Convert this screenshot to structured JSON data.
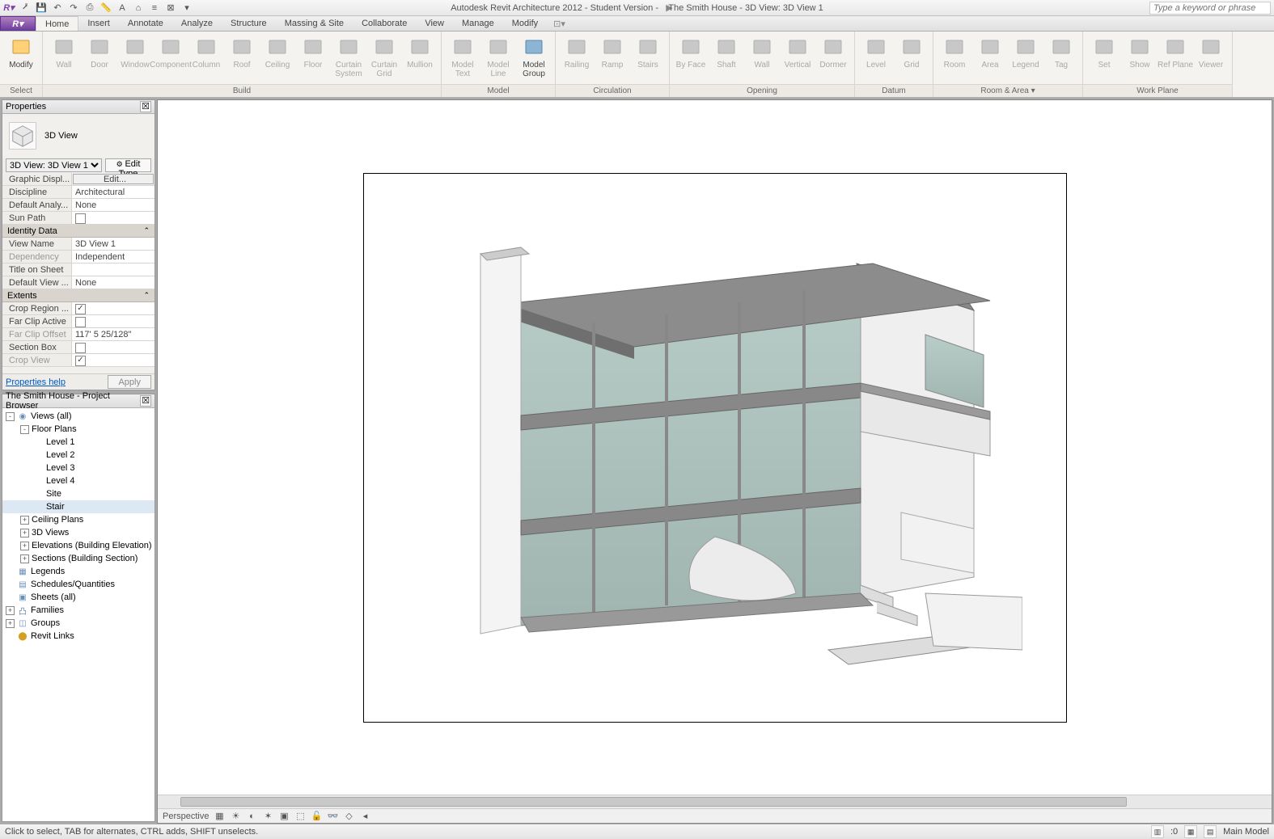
{
  "titlebar": {
    "app": "Autodesk Revit Architecture 2012 - Student Version -",
    "doc": "The Smith House - 3D View: 3D View 1",
    "search_ph": "Type a keyword or phrase"
  },
  "tabs": [
    "Home",
    "Insert",
    "Annotate",
    "Analyze",
    "Structure",
    "Massing & Site",
    "Collaborate",
    "View",
    "Manage",
    "Modify"
  ],
  "active_tab": "Home",
  "ribbon": {
    "select": {
      "title": "Select",
      "items": [
        {
          "id": "modify",
          "label": "Modify",
          "enabled": true,
          "sel": true
        }
      ]
    },
    "build": {
      "title": "Build",
      "items": [
        {
          "id": "wall",
          "label": "Wall"
        },
        {
          "id": "door",
          "label": "Door"
        },
        {
          "id": "window",
          "label": "Window"
        },
        {
          "id": "component",
          "label": "Component"
        },
        {
          "id": "column",
          "label": "Column"
        },
        {
          "id": "roof",
          "label": "Roof"
        },
        {
          "id": "ceiling",
          "label": "Ceiling"
        },
        {
          "id": "floor",
          "label": "Floor"
        },
        {
          "id": "curtain-system",
          "label": "Curtain System"
        },
        {
          "id": "curtain-grid",
          "label": "Curtain Grid"
        },
        {
          "id": "mullion",
          "label": "Mullion"
        }
      ]
    },
    "model": {
      "title": "Model",
      "items": [
        {
          "id": "model-text",
          "label": "Model Text"
        },
        {
          "id": "model-line",
          "label": "Model Line"
        },
        {
          "id": "model-group",
          "label": "Model Group",
          "enabled": true
        }
      ]
    },
    "circulation": {
      "title": "Circulation",
      "items": [
        {
          "id": "railing",
          "label": "Railing"
        },
        {
          "id": "ramp",
          "label": "Ramp"
        },
        {
          "id": "stairs",
          "label": "Stairs"
        }
      ]
    },
    "opening": {
      "title": "Opening",
      "items": [
        {
          "id": "by-face",
          "label": "By Face"
        },
        {
          "id": "shaft",
          "label": "Shaft"
        },
        {
          "id": "wall-open",
          "label": "Wall"
        },
        {
          "id": "vertical",
          "label": "Vertical"
        },
        {
          "id": "dormer",
          "label": "Dormer"
        }
      ]
    },
    "datum": {
      "title": "Datum",
      "items": [
        {
          "id": "level",
          "label": "Level"
        },
        {
          "id": "grid",
          "label": "Grid"
        }
      ]
    },
    "room_area": {
      "title": "Room & Area ▾",
      "items": [
        {
          "id": "room",
          "label": "Room"
        },
        {
          "id": "area",
          "label": "Area"
        },
        {
          "id": "legend",
          "label": "Legend"
        },
        {
          "id": "tag",
          "label": "Tag"
        }
      ]
    },
    "work_plane": {
      "title": "Work Plane",
      "items": [
        {
          "id": "set",
          "label": "Set"
        },
        {
          "id": "show",
          "label": "Show"
        },
        {
          "id": "ref-plane",
          "label": "Ref Plane"
        },
        {
          "id": "viewer",
          "label": "Viewer"
        }
      ]
    }
  },
  "properties": {
    "title": "Properties",
    "type": "3D View",
    "selector": "3D View: 3D View 1",
    "edit_type": "Edit Type",
    "groups": [
      {
        "name": "",
        "rows": [
          {
            "k": "Graphic Displ...",
            "v": "Edit...",
            "btn": true
          },
          {
            "k": "Discipline",
            "v": "Architectural"
          },
          {
            "k": "Default Analy...",
            "v": "None"
          },
          {
            "k": "Sun Path",
            "v": "",
            "chk": true,
            "on": false
          }
        ]
      },
      {
        "name": "Identity Data",
        "rows": [
          {
            "k": "View Name",
            "v": "3D View 1"
          },
          {
            "k": "Dependency",
            "v": "Independent",
            "gray": true
          },
          {
            "k": "Title on Sheet",
            "v": ""
          },
          {
            "k": "Default View ...",
            "v": "None"
          }
        ]
      },
      {
        "name": "Extents",
        "rows": [
          {
            "k": "Crop Region ...",
            "v": "",
            "chk": true,
            "on": true
          },
          {
            "k": "Far Clip Active",
            "v": "",
            "chk": true,
            "on": false
          },
          {
            "k": "Far Clip Offset",
            "v": "117'  5 25/128\"",
            "gray": true
          },
          {
            "k": "Section Box",
            "v": "",
            "chk": true,
            "on": false
          },
          {
            "k": "Crop View",
            "v": "",
            "chk": true,
            "on": true,
            "gray": true
          }
        ]
      }
    ],
    "help": "Properties help",
    "apply": "Apply"
  },
  "browser": {
    "title": "The Smith House - Project Browser",
    "tree": [
      {
        "d": 0,
        "tw": "-",
        "ico": "◉",
        "t": "Views (all)"
      },
      {
        "d": 1,
        "tw": "-",
        "t": "Floor Plans"
      },
      {
        "d": 2,
        "t": "Level 1"
      },
      {
        "d": 2,
        "t": "Level 2"
      },
      {
        "d": 2,
        "t": "Level 3"
      },
      {
        "d": 2,
        "t": "Level 4"
      },
      {
        "d": 2,
        "t": "Site"
      },
      {
        "d": 2,
        "t": "Stair",
        "sel": true
      },
      {
        "d": 1,
        "tw": "+",
        "t": "Ceiling Plans"
      },
      {
        "d": 1,
        "tw": "+",
        "t": "3D Views"
      },
      {
        "d": 1,
        "tw": "+",
        "t": "Elevations (Building Elevation)"
      },
      {
        "d": 1,
        "tw": "+",
        "t": "Sections (Building Section)"
      },
      {
        "d": 0,
        "ico": "▦",
        "t": "Legends"
      },
      {
        "d": 0,
        "ico": "▤",
        "t": "Schedules/Quantities"
      },
      {
        "d": 0,
        "ico": "▣",
        "t": "Sheets (all)"
      },
      {
        "d": 0,
        "tw": "+",
        "ico": "凸",
        "t": "Families"
      },
      {
        "d": 0,
        "tw": "+",
        "ico": "◫",
        "t": "Groups"
      },
      {
        "d": 0,
        "ico": "⬤",
        "t": "Revit Links",
        "icolor": "#d4a020"
      }
    ]
  },
  "viewctrl": {
    "mode": "Perspective"
  },
  "status": {
    "hint": "Click to select, TAB for alternates, CTRL adds, SHIFT unselects.",
    "zoom": ":0",
    "model": "Main Model"
  }
}
